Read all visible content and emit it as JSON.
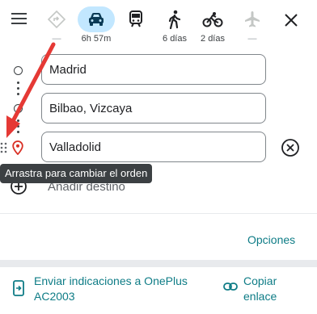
{
  "travel_modes": [
    {
      "key": "best",
      "label": "—",
      "selected": false
    },
    {
      "key": "car",
      "label": "6h 57m",
      "selected": true
    },
    {
      "key": "transit",
      "label": "",
      "selected": false
    },
    {
      "key": "walk",
      "label": "6 días",
      "selected": false
    },
    {
      "key": "bicycle",
      "label": "2 días",
      "selected": false
    },
    {
      "key": "flight",
      "label": "—",
      "selected": false
    }
  ],
  "waypoints": [
    {
      "value": "Madrid"
    },
    {
      "value": "Bilbao, Vizcaya"
    },
    {
      "value": "Valladolid"
    }
  ],
  "tooltip": "Arrastra para cambiar el orden",
  "add_destination": "Añadir destino",
  "options_label": "Opciones",
  "send_to_device": {
    "line1": "Enviar indicaciones a OnePlus",
    "line2": "AC2003"
  },
  "copy_link": {
    "line1": "Copiar",
    "line2": "enlace"
  },
  "colors": {
    "accent": "#0e7c86",
    "selected_mode_bg": "#c2e7ff",
    "annotation_arrow": "#e53935",
    "destination_pin": "#d93025"
  }
}
